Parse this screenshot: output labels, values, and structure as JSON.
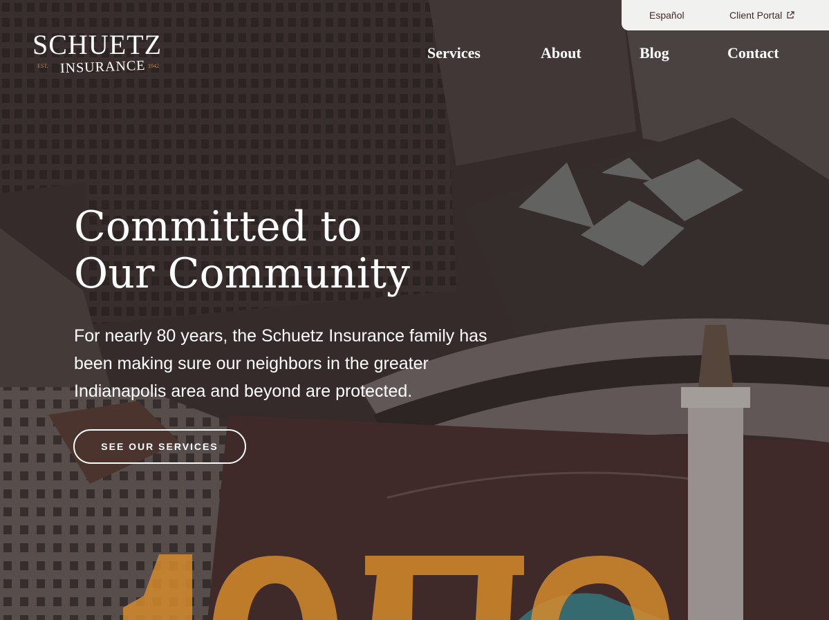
{
  "utility": {
    "language_label": "Español",
    "portal_label": "Client Portal",
    "portal_icon": "external-link-icon"
  },
  "logo": {
    "name": "SCHUETZ",
    "sub": "INSURANCE",
    "est_label": "EST.",
    "year": "1942"
  },
  "nav": {
    "items": [
      {
        "label": "Services"
      },
      {
        "label": "About"
      },
      {
        "label": "Blog"
      },
      {
        "label": "Contact"
      }
    ]
  },
  "hero": {
    "title_line1": "Committed to",
    "title_line2": "Our Community",
    "intro": "For nearly 80 years, the Schuetz Insurance family has been making sure our neighbors in the greater Indianapolis area and beyond are protected.",
    "cta_label": "SEE OUR SERVICES",
    "background": "aerial-city-photo",
    "accent_color": "#d48b2c",
    "overlay_color": "#2d2424"
  }
}
